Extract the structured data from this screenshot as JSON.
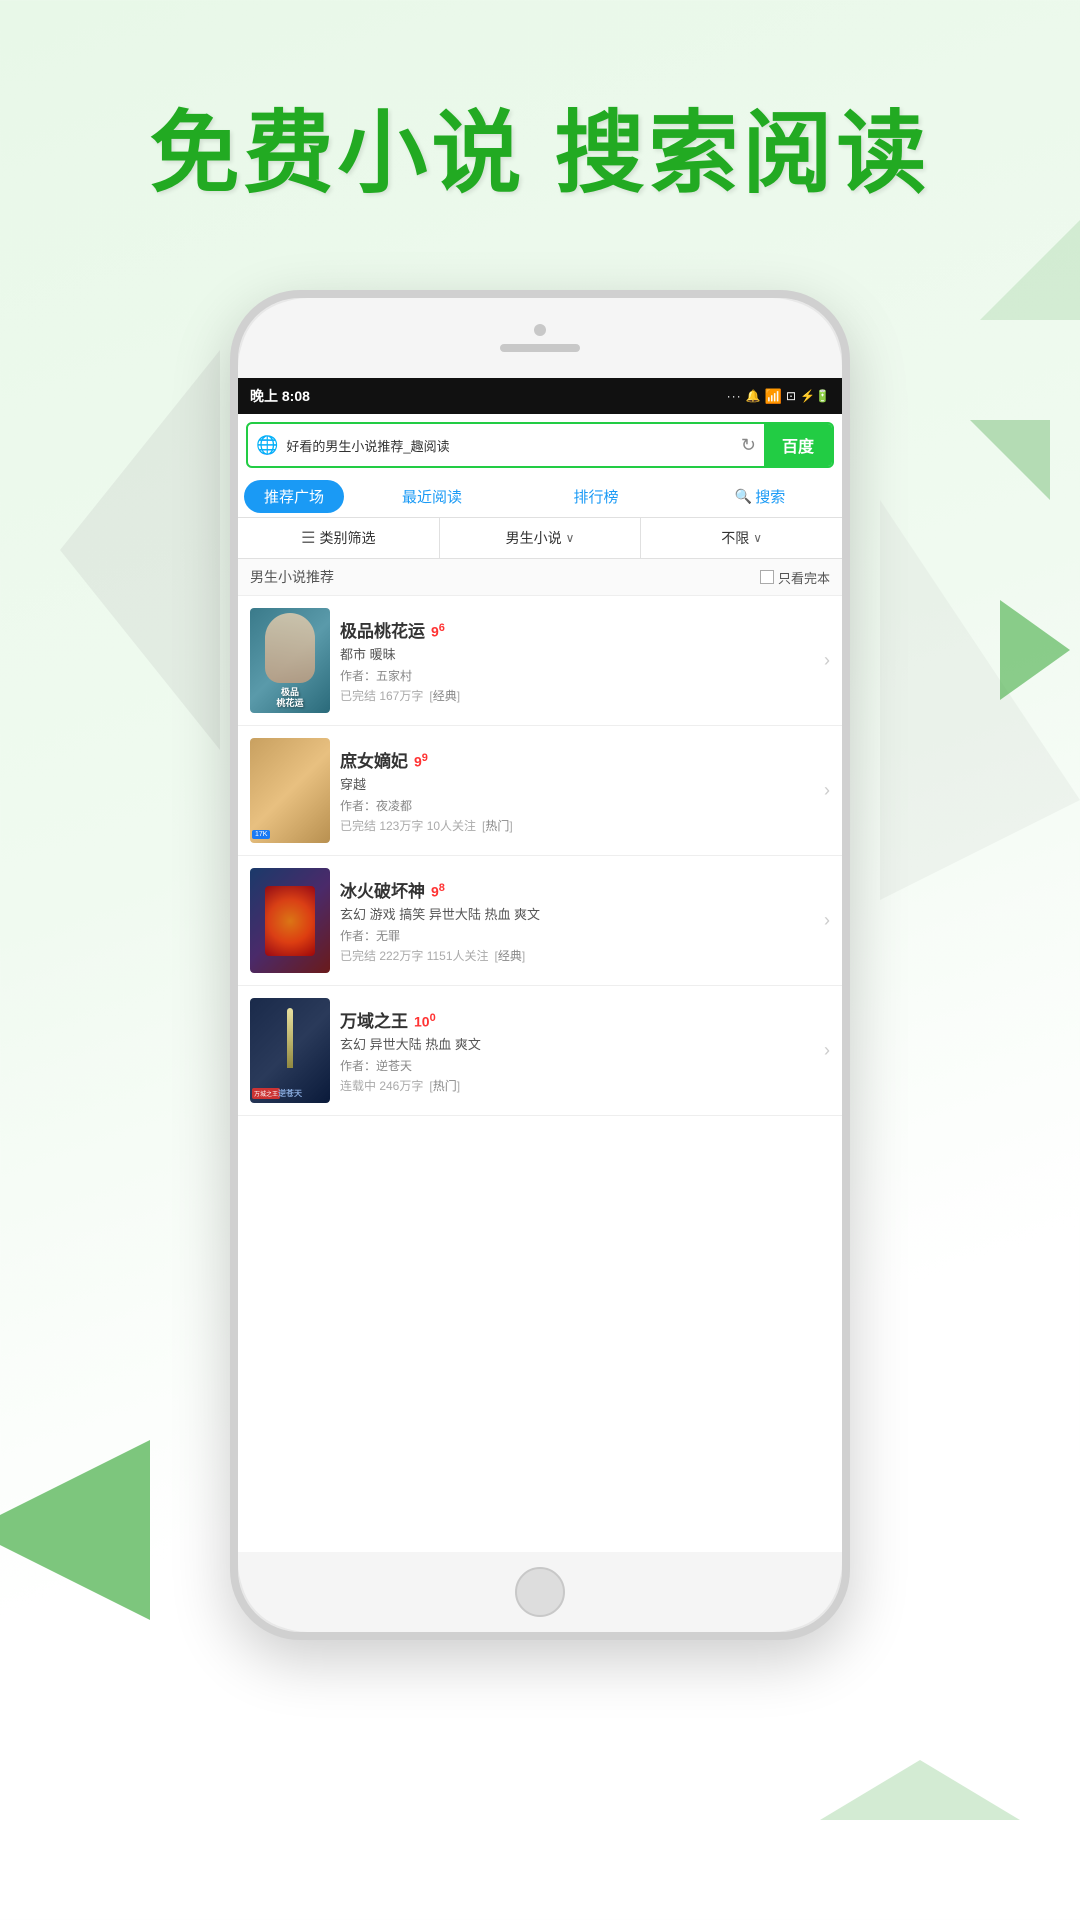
{
  "header": {
    "title": "免费小说  搜索阅读"
  },
  "statusBar": {
    "time": "晚上 8:08",
    "signal": "...",
    "wifi": "WiFi",
    "battery": "充电"
  },
  "searchBar": {
    "query": "好看的男生小说推荐_趣阅读",
    "buttonLabel": "百度"
  },
  "navTabs": [
    {
      "label": "推荐广场",
      "active": true
    },
    {
      "label": "最近阅读",
      "active": false
    },
    {
      "label": "排行榜",
      "active": false
    },
    {
      "label": "搜索",
      "active": false
    }
  ],
  "filterBar": {
    "category": "类别筛选",
    "type": "男生小说",
    "limit": "不限"
  },
  "sectionHeader": {
    "title": "男生小说推荐",
    "checkbox": "只看完本"
  },
  "books": [
    {
      "title": "极品桃花运",
      "rating": "9",
      "ratingDecimal": "6",
      "genre": "都市 暖昧",
      "author": "作者：五家村",
      "meta": "已完结 167万字",
      "tag": "经典",
      "coverType": "1"
    },
    {
      "title": "庶女嫡妃",
      "rating": "9",
      "ratingDecimal": "9",
      "genre": "穿越",
      "author": "作者：夜凌都",
      "meta": "已完结 123万字 10人关注",
      "tag": "热门",
      "coverType": "2"
    },
    {
      "title": "冰火破坏神",
      "rating": "9",
      "ratingDecimal": "8",
      "genre": "玄幻 游戏 搞笑 异世大陆 热血 爽文",
      "author": "作者：无罪",
      "meta": "已完结 222万字 1151人关注",
      "tag": "经典",
      "coverType": "3"
    },
    {
      "title": "万域之王",
      "rating": "10",
      "ratingDecimal": "0",
      "genre": "玄幻 异世大陆 热血 爽文",
      "author": "作者：逆苍天",
      "meta": "连载中 246万字",
      "tag": "热门",
      "coverType": "4"
    }
  ]
}
